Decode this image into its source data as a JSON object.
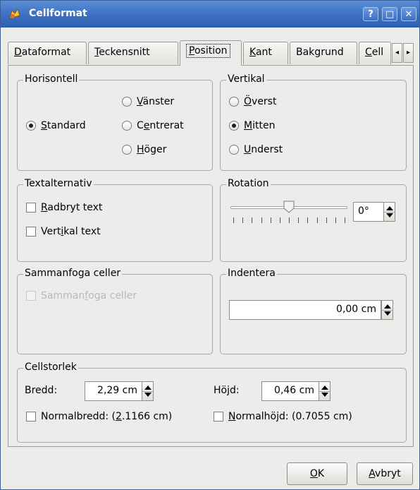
{
  "window": {
    "title": "Cellformat",
    "help_glyph": "?",
    "maximize_glyph": "□",
    "close_glyph": "✕"
  },
  "tabs": [
    {
      "label": "Dataformat",
      "mnemonic": "D",
      "rest": "ataformat"
    },
    {
      "label": "Teckensnitt",
      "mnemonic": "T",
      "rest": "eckensnitt"
    },
    {
      "label": "Position",
      "mnemonic": "P",
      "rest": "osition",
      "active": true
    },
    {
      "label": "Kant",
      "mnemonic": "K",
      "rest": "ant"
    },
    {
      "label": "Bakgrund",
      "pre": "Bak",
      "mnemonic": "g",
      "rest": "rund"
    },
    {
      "label": "Cell",
      "mnemonic": "C",
      "rest": "ell"
    }
  ],
  "tab_scroll": {
    "left": "◂",
    "right": "▸"
  },
  "horisontell": {
    "title": "Horisontell",
    "standard": {
      "mnemonic": "S",
      "rest": "tandard",
      "checked": true
    },
    "vanster": {
      "mnemonic": "V",
      "rest": "änster",
      "checked": false
    },
    "centrerat": {
      "pre": "C",
      "mnemonic": "e",
      "rest": "ntrerat",
      "checked": false
    },
    "hoger": {
      "mnemonic": "H",
      "rest": "öger",
      "checked": false
    }
  },
  "vertikal": {
    "title": "Vertikal",
    "overst": {
      "mnemonic": "Ö",
      "rest": "verst",
      "checked": false
    },
    "mitten": {
      "mnemonic": "M",
      "rest": "itten",
      "checked": true
    },
    "underst": {
      "mnemonic": "U",
      "rest": "nderst",
      "checked": false
    }
  },
  "textalternativ": {
    "title": "Textalternativ",
    "radbryt": {
      "mnemonic": "R",
      "rest": "adbryt text",
      "checked": false
    },
    "vertikal_text": {
      "pre": "Vert",
      "mnemonic": "i",
      "rest": "kal text",
      "checked": false
    }
  },
  "rotation": {
    "title": "Rotation",
    "value": "0°",
    "level_fraction": 0.5,
    "tick_count": 13
  },
  "sammanfoga": {
    "title": "Sammanfoga celler",
    "checkbox": {
      "pre": "Samman",
      "mnemonic": "f",
      "rest": "oga celler",
      "checked": false,
      "enabled": false
    }
  },
  "indentera": {
    "title": "Indentera",
    "value": "0,00 cm"
  },
  "cellstorlek": {
    "title": "Cellstorlek",
    "bredd_label": "Bredd:",
    "bredd_value": "2,29 cm",
    "hojd_label": "Höjd:",
    "hojd_value": "0,46 cm",
    "normalbredd": {
      "pre": "Normalbredd: (",
      "mnemonic": "2",
      "rest": ".1166 cm)",
      "checked": false
    },
    "normalhojd": {
      "mnemonic": "N",
      "rest": "ormalhöjd: (0.7055 cm)",
      "checked": false
    }
  },
  "buttons": {
    "ok": {
      "mnemonic": "O",
      "rest": "K"
    },
    "avbryt": {
      "mnemonic": "A",
      "rest": "vbryt"
    }
  },
  "colors": {
    "titlebar": "#3b6fc0",
    "dialog_bg": "#ececea",
    "text": "#000000",
    "disabled_text": "#b9b9b6"
  }
}
